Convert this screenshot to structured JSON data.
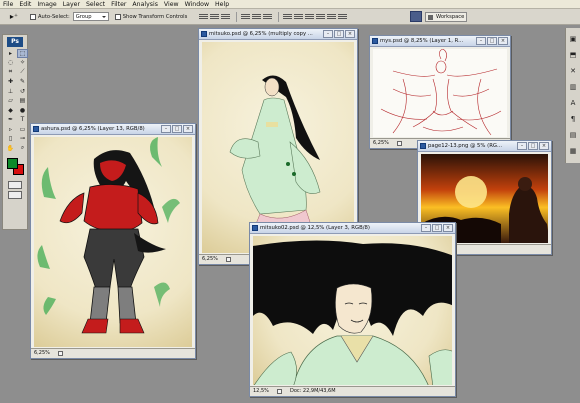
{
  "menu": [
    "File",
    "Edit",
    "Image",
    "Layer",
    "Select",
    "Filter",
    "Analysis",
    "View",
    "Window",
    "Help"
  ],
  "options": {
    "auto_select_label": "Auto-Select:",
    "auto_select_value": "Group",
    "transform_label": "Show Transform Controls",
    "workspace_label": "Workspace"
  },
  "toolbox": {
    "logo": "Ps",
    "colors": {
      "foreground": "#0e8a2a",
      "background": "#d70f0f"
    }
  },
  "documents": {
    "mitsuko": {
      "title": "mitsuko.psd @ 6,25% (multiply copy ...",
      "zoom": "6,25%"
    },
    "mys": {
      "title": "mys.psd @ 8,25% (Layer 1, R...",
      "zoom": "6,25%"
    },
    "ashura": {
      "title": "ashura.psd @ 6,25% (Layer 13, RGB/8)",
      "zoom": "6,25%"
    },
    "page12": {
      "title": "page12-13.png @ 5% (RG...",
      "zoom": ""
    },
    "mitsuko02": {
      "title": "mitsuko02.psd @ 12,5% (Layer 3, RGB/8)",
      "zoom": "12,5%",
      "doc_info": "Doc: 22,9M/43,6M"
    }
  }
}
